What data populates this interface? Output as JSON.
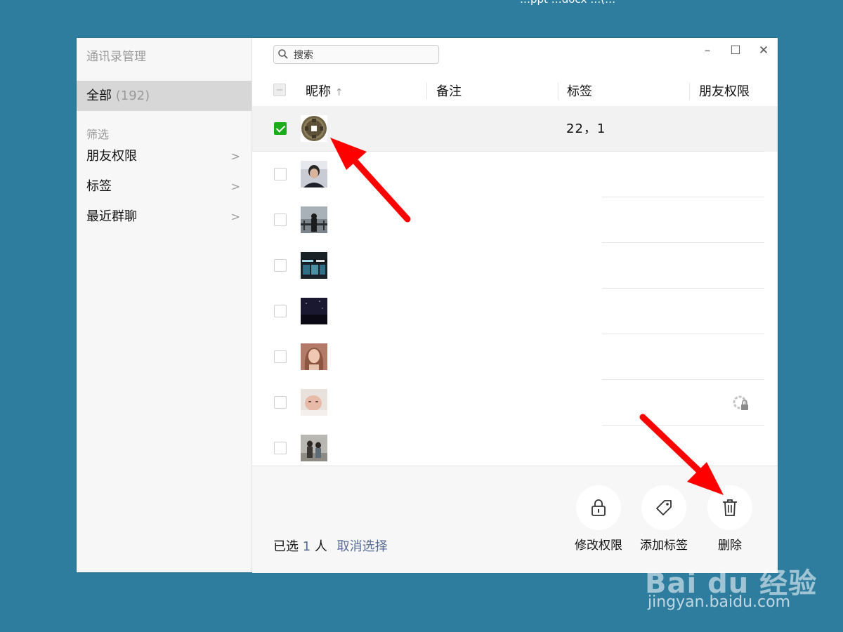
{
  "top_strip": "…ppt   …docx   …(…",
  "sidebar": {
    "title": "通讯录管理",
    "all_label": "全部",
    "all_count": "(192)",
    "filter_label": "筛选",
    "items": [
      {
        "label": "朋友权限"
      },
      {
        "label": "标签"
      },
      {
        "label": "最近群聊"
      }
    ]
  },
  "search": {
    "placeholder": "搜索"
  },
  "window_controls": {
    "minimize": "–",
    "maximize": "☐",
    "close": "✕"
  },
  "columns": {
    "nickname": "昵称",
    "sort_arrow": "↑",
    "remark": "备注",
    "tags": "标签",
    "permission": "朋友权限"
  },
  "rows": [
    {
      "checked": true,
      "tags": "22，1",
      "avatar": "coin-avatar"
    },
    {
      "checked": false,
      "tags": "",
      "avatar": "portrait-avatar"
    },
    {
      "checked": false,
      "tags": "",
      "avatar": "silhouette-avatar"
    },
    {
      "checked": false,
      "tags": "",
      "avatar": "storefront-avatar"
    },
    {
      "checked": false,
      "tags": "",
      "avatar": "night-sky-avatar"
    },
    {
      "checked": false,
      "tags": "",
      "avatar": "girl-avatar"
    },
    {
      "checked": false,
      "tags": "",
      "avatar": "face-avatar",
      "permission_icon": "lock-icon"
    },
    {
      "checked": false,
      "tags": "",
      "avatar": "couple-avatar"
    }
  ],
  "selection": {
    "prefix": "已选",
    "count": "1",
    "suffix": "人",
    "cancel": "取消选择"
  },
  "actions": [
    {
      "label": "修改权限",
      "icon": "lock-icon"
    },
    {
      "label": "添加标签",
      "icon": "tag-icon"
    },
    {
      "label": "删除",
      "icon": "trash-icon"
    }
  ],
  "watermark": {
    "brand": "Bai du 经验",
    "url": "jingyan.baidu.com"
  },
  "colors": {
    "background": "#2e7d9e",
    "checkbox_green": "#1aad19",
    "link_blue": "#576b95",
    "arrow_red": "#ff0000"
  }
}
